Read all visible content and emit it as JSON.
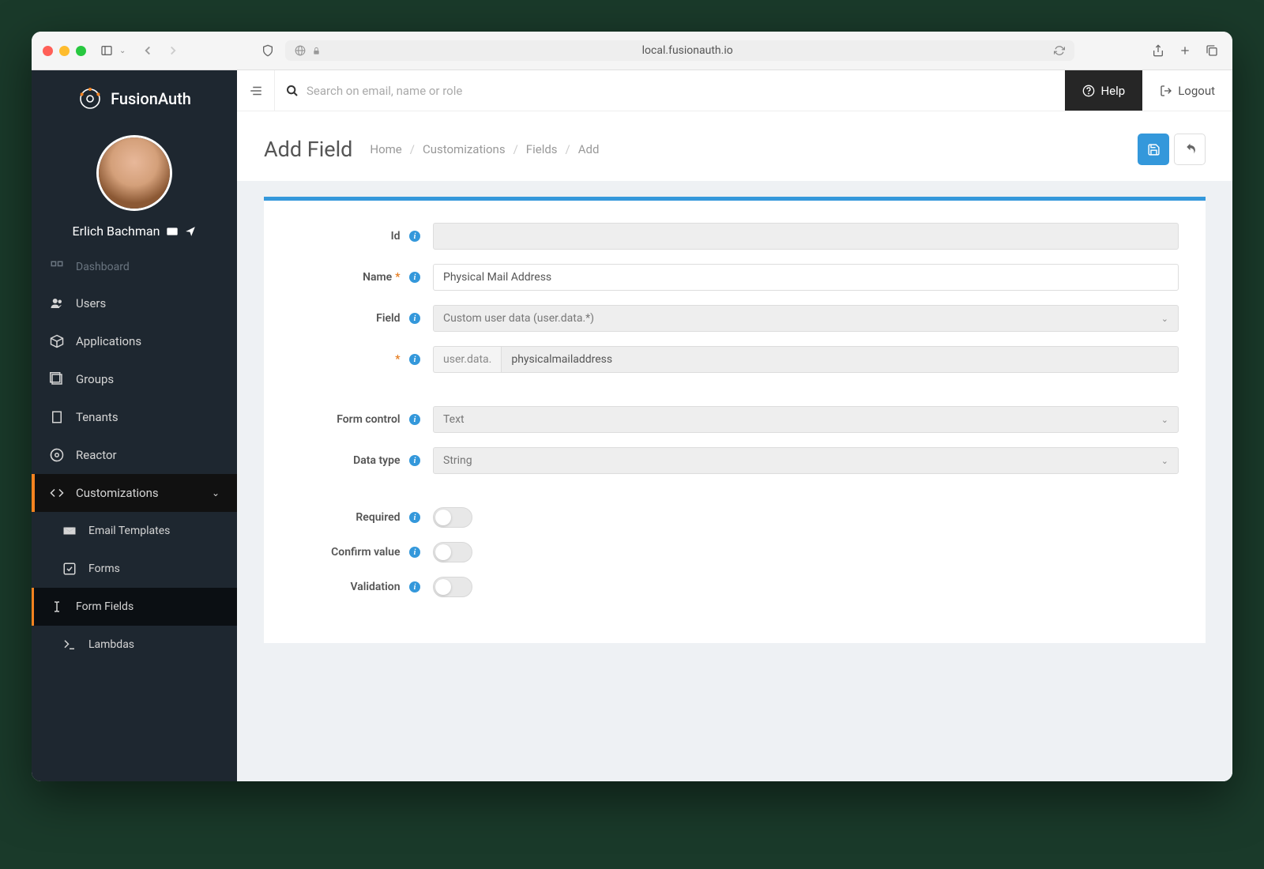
{
  "browser": {
    "url": "local.fusionauth.io"
  },
  "brand": {
    "name": "FusionAuth"
  },
  "user": {
    "name": "Erlich Bachman"
  },
  "sidebar": {
    "items": [
      {
        "label": "Dashboard",
        "icon": "dashboard"
      },
      {
        "label": "Users",
        "icon": "users"
      },
      {
        "label": "Applications",
        "icon": "cube"
      },
      {
        "label": "Groups",
        "icon": "groups"
      },
      {
        "label": "Tenants",
        "icon": "building"
      },
      {
        "label": "Reactor",
        "icon": "reactor"
      },
      {
        "label": "Customizations",
        "icon": "code",
        "expanded": true
      },
      {
        "label": "Email Templates",
        "icon": "envelope",
        "sub": true
      },
      {
        "label": "Forms",
        "icon": "check-square",
        "sub": true
      },
      {
        "label": "Form Fields",
        "icon": "text-cursor",
        "sub": true,
        "selected": true
      },
      {
        "label": "Lambdas",
        "icon": "terminal",
        "sub": true
      }
    ]
  },
  "topbar": {
    "search_placeholder": "Search on email, name or role",
    "help": "Help",
    "logout": "Logout"
  },
  "header": {
    "title": "Add Field",
    "breadcrumb": [
      "Home",
      "Customizations",
      "Fields",
      "Add"
    ]
  },
  "form": {
    "id_label": "Id",
    "id_value": "",
    "name_label": "Name",
    "name_value": "Physical Mail Address",
    "field_label": "Field",
    "field_value": "Custom user data (user.data.*)",
    "key_prefix": "user.data.",
    "key_value": "physicalmailaddress",
    "form_control_label": "Form control",
    "form_control_value": "Text",
    "data_type_label": "Data type",
    "data_type_value": "String",
    "required_label": "Required",
    "confirm_label": "Confirm value",
    "validation_label": "Validation"
  }
}
